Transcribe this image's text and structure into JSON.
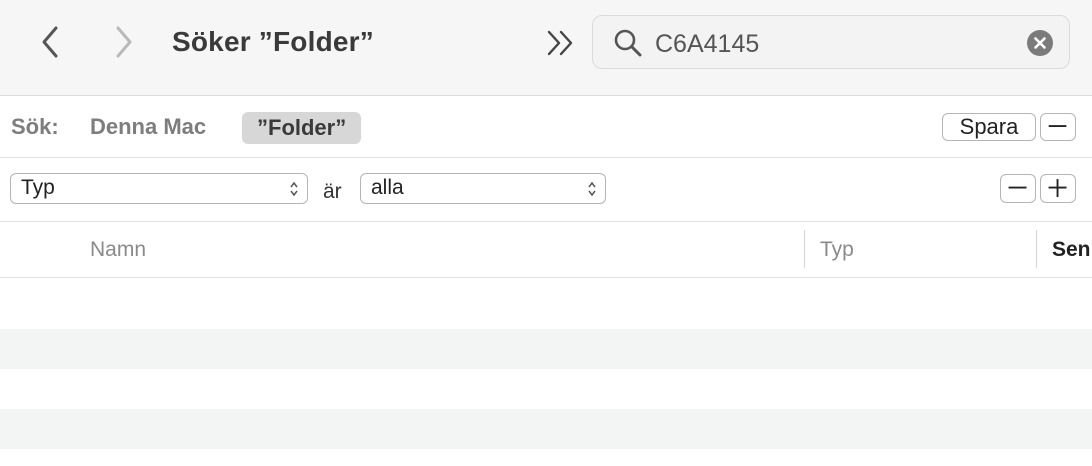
{
  "toolbar": {
    "title": "Söker ”Folder”",
    "search_value": "C6A4145",
    "icons": {
      "back": "chevron-left-icon",
      "forward": "chevron-right-icon",
      "more": "double-chevron-right-icon",
      "search": "magnifier-icon",
      "clear": "clear-circle-x-icon"
    }
  },
  "scope": {
    "label": "Sök:",
    "items": [
      {
        "label": "Denna Mac",
        "selected": false
      },
      {
        "label": "”Folder”",
        "selected": true
      }
    ],
    "save_label": "Spara",
    "minus_label": "−"
  },
  "criteria": {
    "attribute": "Typ",
    "operator_text": "är",
    "value": "alla",
    "minus_label": "−",
    "plus_label": "+"
  },
  "columns": [
    "Namn",
    "Typ",
    "Sen"
  ],
  "rows": [
    {
      "alt": false
    },
    {
      "alt": true
    },
    {
      "alt": false
    },
    {
      "alt": true
    }
  ]
}
